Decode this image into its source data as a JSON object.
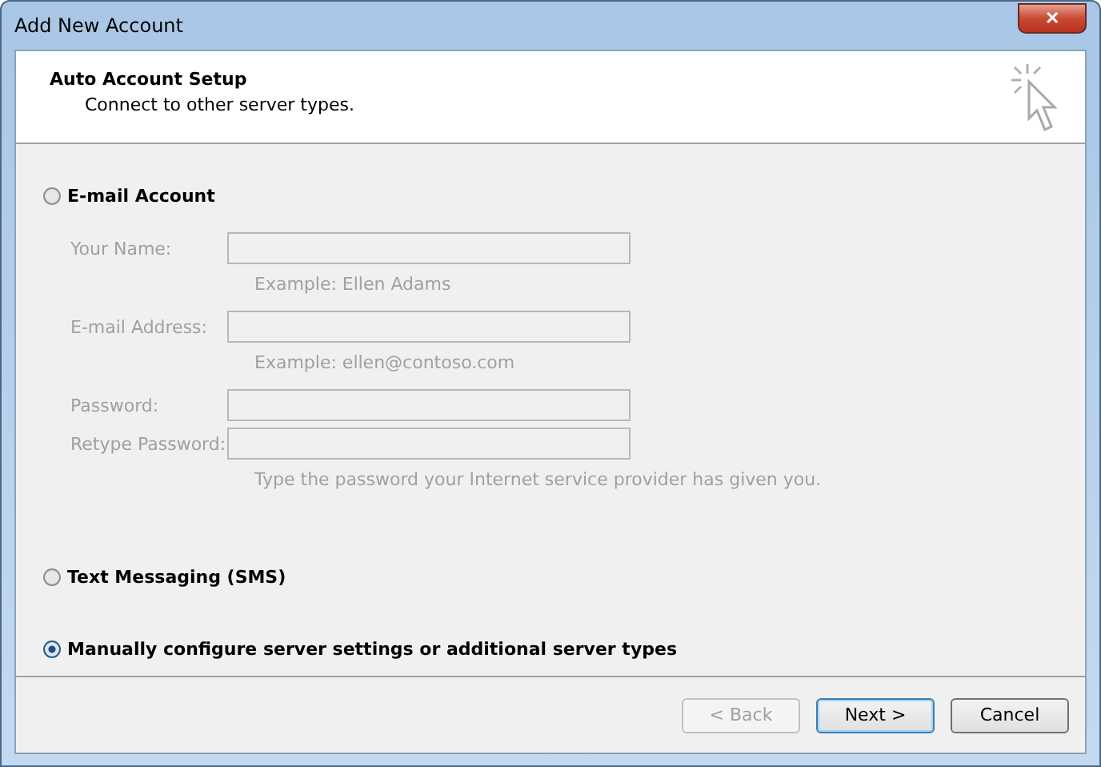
{
  "window": {
    "title": "Add New Account",
    "close": "✕"
  },
  "header": {
    "title": "Auto Account Setup",
    "subtitle": "Connect to other server types."
  },
  "options": [
    {
      "kind": "group",
      "label": "E-mail Account",
      "selected": false,
      "disabled": true,
      "fields": [
        {
          "label": "Your Name:",
          "hint": "Example: Ellen Adams"
        },
        {
          "label": "E-mail Address:",
          "hint": "Example: ellen@contoso.com"
        },
        {
          "label": "Password:"
        },
        {
          "label": "Retype Password:",
          "hint": "Type the password your Internet service provider has given you."
        }
      ]
    },
    {
      "kind": "plain",
      "label": "Text Messaging (SMS)",
      "selected": false
    },
    {
      "kind": "plain",
      "label": "Manually configure server settings or additional server types",
      "selected": true
    }
  ],
  "buttons": [
    {
      "label": "< Back",
      "disabled": true,
      "default": false
    },
    {
      "label": "Next >",
      "disabled": false,
      "default": true
    },
    {
      "label": "Cancel",
      "disabled": false,
      "default": false
    }
  ]
}
